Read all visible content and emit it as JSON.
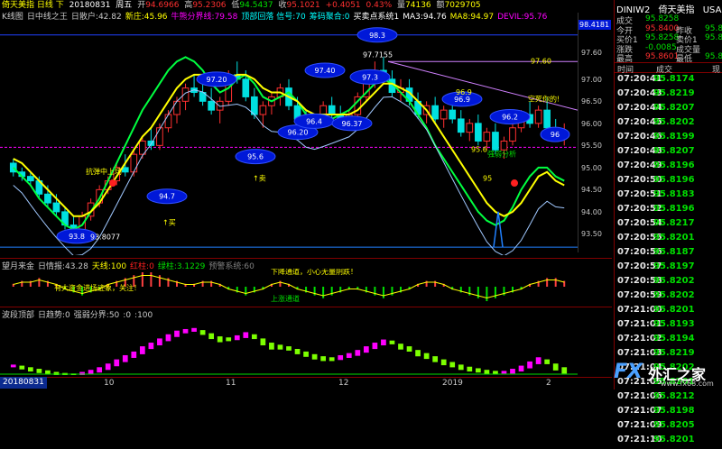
{
  "header": {
    "title": "倚天美指 日线 下",
    "date": "20180831",
    "weekday": "周五",
    "open_label": "开",
    "open": "94.6966",
    "high_label": "高",
    "high": "95.2306",
    "low_label": "低",
    "low": "94.5437",
    "close_label": "收",
    "close": "95.1021",
    "change": "+0.4051",
    "change_pct": "0.43%",
    "volume_label": "量",
    "volume": "74136",
    "amount_label": "额",
    "amount": "7029705"
  },
  "legend": [
    {
      "text": "K线图",
      "color": "#c8c8c8"
    },
    {
      "text": "日中线之王",
      "color": "#c8c8c8"
    },
    {
      "text": "日散户:42.82",
      "color": "#c8c8c8"
    },
    {
      "text": "新庄:45.96",
      "color": "#ffff00"
    },
    {
      "text": "牛熊分界线:79.58",
      "color": "#ff00ff"
    },
    {
      "text": "顶部回落 信号:70",
      "color": "#00ffff"
    },
    {
      "text": "筹码聚合:0",
      "color": "#00ffff"
    },
    {
      "text": "买卖点系统1",
      "color": "#ffffff"
    },
    {
      "text": "MA3:94.76",
      "color": "#ffffff"
    },
    {
      "text": "MA8:94.97",
      "color": "#ffff00"
    },
    {
      "text": "DEVIL:95.76",
      "color": "#ff00ff"
    }
  ],
  "price_top": "98.4181",
  "yticks": [
    {
      "v": "97.60"
    },
    {
      "v": "97.00"
    },
    {
      "v": "96.50"
    },
    {
      "v": "96.00"
    },
    {
      "v": "95.50"
    },
    {
      "v": "95.00"
    },
    {
      "v": "94.50"
    },
    {
      "v": "94.00"
    },
    {
      "v": "93.50"
    }
  ],
  "chart_data": {
    "type": "candlestick",
    "ylim": [
      93.4,
      98.5
    ],
    "ticks_y": [
      97.6,
      97.0,
      96.5,
      96.0,
      95.5,
      95.0,
      94.5,
      94.0,
      93.5
    ],
    "candles": [
      [
        95.4,
        95.5,
        95.1,
        95.2
      ],
      [
        95.2,
        95.3,
        95.0,
        95.1
      ],
      [
        95.1,
        95.2,
        94.9,
        95.0
      ],
      [
        95.0,
        95.1,
        94.6,
        94.7
      ],
      [
        94.7,
        94.9,
        94.4,
        94.5
      ],
      [
        94.5,
        94.7,
        94.2,
        94.3
      ],
      [
        94.3,
        94.4,
        93.9,
        94.0
      ],
      [
        94.0,
        94.2,
        93.8,
        93.9
      ],
      [
        93.9,
        94.3,
        93.8,
        94.2
      ],
      [
        94.2,
        94.6,
        94.1,
        94.5
      ],
      [
        94.5,
        94.9,
        94.4,
        94.8
      ],
      [
        94.8,
        95.1,
        94.7,
        95.0
      ],
      [
        95.0,
        95.4,
        94.9,
        95.3
      ],
      [
        95.3,
        95.6,
        95.1,
        95.2
      ],
      [
        95.2,
        95.7,
        95.1,
        95.6
      ],
      [
        95.6,
        96.0,
        95.5,
        95.9
      ],
      [
        95.9,
        96.2,
        95.7,
        95.8
      ],
      [
        95.8,
        96.3,
        95.7,
        96.2
      ],
      [
        96.2,
        96.6,
        96.1,
        96.5
      ],
      [
        96.5,
        96.9,
        96.3,
        96.8
      ],
      [
        96.8,
        97.2,
        96.6,
        97.1
      ],
      [
        97.1,
        97.4,
        96.9,
        97.0
      ],
      [
        97.0,
        97.3,
        96.7,
        96.8
      ],
      [
        96.8,
        97.1,
        96.5,
        96.6
      ],
      [
        96.6,
        96.9,
        96.3,
        96.8
      ],
      [
        96.8,
        97.5,
        96.7,
        97.4
      ],
      [
        97.4,
        97.7,
        97.2,
        97.3
      ],
      [
        97.3,
        97.5,
        96.8,
        96.9
      ],
      [
        96.9,
        97.1,
        96.4,
        96.5
      ],
      [
        96.5,
        96.8,
        96.2,
        96.7
      ],
      [
        96.7,
        97.0,
        96.5,
        96.9
      ],
      [
        96.9,
        97.2,
        96.7,
        97.1
      ],
      [
        97.1,
        97.3,
        96.6,
        96.7
      ],
      [
        96.7,
        96.9,
        96.3,
        96.4
      ],
      [
        96.4,
        96.6,
        96.1,
        96.2
      ],
      [
        96.2,
        96.5,
        96.1,
        96.4
      ],
      [
        96.4,
        96.8,
        96.3,
        96.7
      ],
      [
        96.7,
        96.9,
        96.4,
        96.5
      ],
      [
        96.5,
        96.7,
        96.2,
        96.3
      ],
      [
        96.3,
        96.6,
        96.2,
        96.5
      ],
      [
        96.5,
        97.0,
        96.4,
        96.9
      ],
      [
        96.9,
        97.4,
        96.8,
        97.3
      ],
      [
        97.3,
        97.7,
        97.1,
        97.5
      ],
      [
        97.5,
        97.8,
        97.2,
        97.3
      ],
      [
        97.3,
        97.5,
        96.9,
        97.0
      ],
      [
        97.0,
        97.3,
        96.8,
        97.1
      ],
      [
        97.1,
        97.3,
        96.7,
        96.8
      ],
      [
        96.8,
        97.0,
        96.4,
        96.5
      ],
      [
        96.5,
        96.8,
        96.3,
        96.7
      ],
      [
        96.7,
        96.9,
        96.3,
        96.4
      ],
      [
        96.4,
        96.7,
        96.2,
        96.6
      ],
      [
        96.6,
        96.9,
        96.3,
        96.4
      ],
      [
        96.4,
        96.6,
        96.0,
        96.1
      ],
      [
        96.1,
        96.4,
        95.9,
        96.3
      ],
      [
        96.3,
        96.5,
        95.8,
        95.9
      ],
      [
        95.9,
        96.2,
        95.7,
        96.1
      ],
      [
        96.1,
        96.3,
        95.6,
        95.7
      ],
      [
        95.7,
        96.0,
        95.5,
        95.9
      ],
      [
        95.9,
        96.3,
        95.8,
        96.2
      ],
      [
        96.2,
        96.6,
        96.1,
        96.5
      ],
      [
        96.5,
        96.8,
        96.2,
        96.3
      ],
      [
        96.3,
        96.7,
        96.2,
        96.6
      ],
      [
        96.6,
        96.9,
        96.1,
        96.2
      ],
      [
        96.2,
        96.4,
        95.9,
        96.0
      ],
      [
        96.0,
        96.3,
        95.8,
        96.1
      ]
    ],
    "ma_yellow": [
      95.5,
      95.4,
      95.2,
      95.0,
      94.8,
      94.6,
      94.4,
      94.2,
      94.2,
      94.3,
      94.5,
      94.8,
      95.1,
      95.4,
      95.7,
      96.0,
      96.2,
      96.5,
      96.8,
      97.1,
      97.3,
      97.4,
      97.4,
      97.3,
      97.2,
      97.3,
      97.4,
      97.4,
      97.3,
      97.1,
      97.0,
      97.0,
      96.9,
      96.8,
      96.6,
      96.5,
      96.5,
      96.5,
      96.5,
      96.5,
      96.6,
      96.8,
      97.0,
      97.2,
      97.2,
      97.1,
      97.0,
      96.8,
      96.6,
      96.3,
      96.0,
      95.7,
      95.4,
      95.1,
      94.8,
      94.5,
      94.3,
      94.2,
      94.3,
      94.5,
      94.8,
      95.1,
      95.2,
      95.0,
      94.9
    ],
    "ma_green": [
      95.3,
      95.1,
      94.9,
      94.6,
      94.4,
      94.2,
      94.0,
      93.9,
      94.0,
      94.3,
      94.6,
      95.0,
      95.4,
      95.8,
      96.2,
      96.6,
      96.9,
      97.2,
      97.5,
      97.7,
      97.8,
      97.7,
      97.5,
      97.2,
      97.0,
      97.1,
      97.3,
      97.4,
      97.2,
      96.9,
      96.8,
      96.9,
      97.0,
      96.8,
      96.5,
      96.3,
      96.3,
      96.4,
      96.5,
      96.6,
      96.8,
      97.0,
      97.2,
      97.3,
      97.2,
      97.0,
      96.8,
      96.5,
      96.2,
      95.8,
      95.5,
      95.2,
      94.9,
      94.6,
      94.3,
      94.1,
      94.0,
      94.1,
      94.4,
      94.8,
      95.1,
      95.3,
      95.3,
      95.1,
      95.0
    ],
    "devil_level": 95.76,
    "sub1_values": [
      1,
      2,
      2,
      3,
      2,
      1,
      -1,
      -2,
      -3,
      -2,
      -1,
      1,
      2,
      3,
      4,
      5,
      5,
      4,
      3,
      2,
      1,
      1,
      2,
      2,
      1,
      -1,
      -2,
      -3,
      -2,
      -1,
      1,
      2,
      1,
      -1,
      -2,
      -3,
      -4,
      -3,
      -2,
      -1,
      -1,
      -2,
      -3,
      -4,
      -3,
      -2,
      -1,
      1,
      2,
      2,
      1,
      -1,
      -2,
      -3,
      -4,
      -5,
      -4,
      -3,
      -2,
      -1,
      1,
      2,
      3,
      3,
      2
    ],
    "sub2_values": [
      20,
      18,
      15,
      12,
      9,
      6,
      4,
      3,
      6,
      10,
      15,
      22,
      30,
      38,
      45,
      55,
      62,
      70,
      78,
      85,
      88,
      90,
      86,
      80,
      74,
      72,
      76,
      82,
      78,
      70,
      62,
      58,
      55,
      50,
      45,
      40,
      36,
      34,
      38,
      42,
      48,
      55,
      62,
      68,
      66,
      60,
      55,
      48,
      42,
      36,
      30,
      25,
      20,
      16,
      13,
      10,
      8,
      8,
      12,
      18,
      26,
      34,
      30,
      22,
      15
    ]
  },
  "annotations": [
    {
      "text": "93.8",
      "kind": "oval"
    },
    {
      "text": "94.7",
      "kind": "oval"
    },
    {
      "text": "95.6",
      "kind": "oval"
    },
    {
      "text": "96.20",
      "kind": "oval"
    },
    {
      "text": "96.4",
      "kind": "oval"
    },
    {
      "text": "96.37",
      "kind": "oval"
    },
    {
      "text": "97.20",
      "kind": "oval"
    },
    {
      "text": "97.40",
      "kind": "oval"
    },
    {
      "text": "97.3",
      "kind": "oval"
    },
    {
      "text": "98.3",
      "kind": "oval"
    },
    {
      "text": "96.2",
      "kind": "oval"
    },
    {
      "text": "96",
      "kind": "oval"
    },
    {
      "text": "96.9",
      "kind": "oval"
    },
    {
      "text": "97.7155",
      "kind": "label"
    },
    {
      "text": "97.60",
      "kind": "label"
    },
    {
      "text": "96.9",
      "kind": "label"
    },
    {
      "text": "95.6",
      "kind": "label"
    },
    {
      "text": "95",
      "kind": "label"
    },
    {
      "text": "93.8077",
      "kind": "label"
    },
    {
      "text": "↑买",
      "kind": "buy"
    },
    {
      "text": "↑卖",
      "kind": "sell"
    },
    {
      "text": "抗弹中上场",
      "kind": "label"
    },
    {
      "text": "空死你的!",
      "kind": "label"
    },
    {
      "text": "强弱分析",
      "kind": "label"
    }
  ],
  "sub1": {
    "title": "望月来金",
    "items": [
      {
        "text": "日情报:43.28",
        "color": "#c8c8c8"
      },
      {
        "text": "天线:100",
        "color": "#ffff00"
      },
      {
        "text": "红柱:0",
        "color": "#ff2020"
      },
      {
        "text": "绿柱:3.1229",
        "color": "#00e000"
      },
      {
        "text": "预警系统:60",
        "color": "#808080"
      }
    ],
    "notes": [
      {
        "text": "下降通道，小心无量阴跌！",
        "color": "#ffff00"
      },
      {
        "text": "有大资金进场迹象，关注！",
        "color": "#ffff00"
      },
      {
        "text": "上涨通道",
        "color": "#00e000"
      }
    ]
  },
  "sub2": {
    "title": "波段顶部",
    "items": [
      {
        "text": "日趋势:0",
        "color": "#c8c8c8"
      },
      {
        "text": "强弱分界:50",
        "color": "#c8c8c8"
      },
      {
        "text": ":0",
        ":20": ":80",
        "color": "#c8c8c8"
      },
      {
        "text": ":100",
        "color": "#c8c8c8"
      }
    ]
  },
  "xaxis": {
    "date": "20180831",
    "labels": [
      "10",
      "11",
      "12",
      "2019",
      "2"
    ]
  },
  "side": {
    "symbol": "DINIW2",
    "name": "倚天美指",
    "market": "USA",
    "rows": [
      {
        "l": "成交",
        "v": "95.8258",
        "vc": "#00e000",
        "l2": "",
        "v2": ""
      },
      {
        "l": "今开",
        "v": "95.8400",
        "vc": "#ff3030",
        "l2": "昨收",
        "v2": "95.8"
      },
      {
        "l": "买价1",
        "v": "95.8258",
        "vc": "#00e000",
        "l2": "卖价1",
        "v2": "95.8"
      },
      {
        "l": "涨跌",
        "v": "-0.0085",
        "vc": "#00e000",
        "l2": "成交量",
        "v2": ""
      },
      {
        "l": "最高",
        "v": "95.8601",
        "vc": "#ff3030",
        "l2": "最低",
        "v2": "95.8"
      }
    ],
    "tl_headers": [
      "时间",
      "成交",
      "现"
    ],
    "ticks": [
      {
        "t": "07:20:41",
        "p": "95.8174"
      },
      {
        "t": "07:20:43",
        "p": "95.8219"
      },
      {
        "t": "07:20:44",
        "p": "95.8207"
      },
      {
        "t": "07:20:45",
        "p": "95.8202"
      },
      {
        "t": "07:20:46",
        "p": "95.8199"
      },
      {
        "t": "07:20:48",
        "p": "95.8207"
      },
      {
        "t": "07:20:49",
        "p": "95.8196"
      },
      {
        "t": "07:20:50",
        "p": "95.8196"
      },
      {
        "t": "07:20:51",
        "p": "95.8183"
      },
      {
        "t": "07:20:52",
        "p": "95.8196"
      },
      {
        "t": "07:20:54",
        "p": "95.8217"
      },
      {
        "t": "07:20:55",
        "p": "95.8201"
      },
      {
        "t": "07:20:56",
        "p": "95.8187"
      },
      {
        "t": "07:20:57",
        "p": "95.8197"
      },
      {
        "t": "07:20:58",
        "p": "95.8202"
      },
      {
        "t": "07:20:59",
        "p": "95.8202"
      },
      {
        "t": "07:21:00",
        "p": "95.8201"
      },
      {
        "t": "07:21:01",
        "p": "95.8193"
      },
      {
        "t": "07:21:02",
        "p": "95.8194"
      },
      {
        "t": "07:21:03",
        "p": "95.8219"
      },
      {
        "t": "07:21:04",
        "p": "95.8202"
      },
      {
        "t": "07:21:05",
        "p": "95.8201"
      },
      {
        "t": "07:21:06",
        "p": "95.8212"
      },
      {
        "t": "07:21:07",
        "p": "95.8198"
      },
      {
        "t": "07:21:09",
        "p": "95.8205"
      },
      {
        "t": "07:21:10",
        "p": "95.8201"
      }
    ]
  },
  "logo": {
    "text": "外汇之家",
    "url_text": "www.fx68.com",
    "brand": "FX"
  },
  "colors": {
    "up": "#ff3030",
    "down": "#00e0e0",
    "ma_yellow": "#ffff00",
    "ma_green": "#00ff40",
    "devil": "#ff00ff",
    "oval": "#0018d8",
    "sub1_red": "#ff4040",
    "sub2_green": "#7cff00",
    "sub2_magenta": "#ff00ff"
  }
}
